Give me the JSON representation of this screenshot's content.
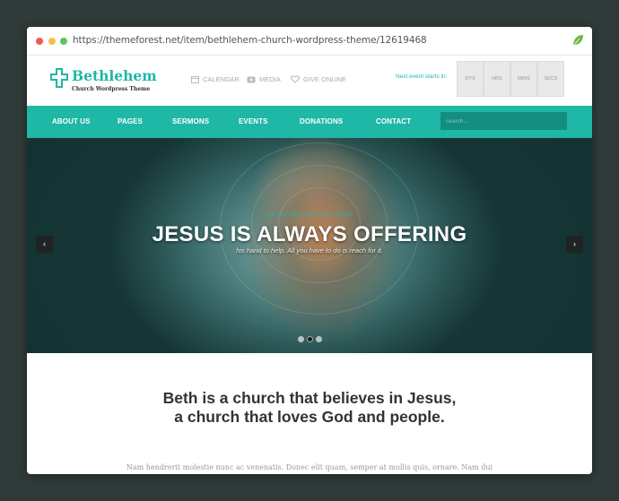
{
  "browser": {
    "url": "https://themeforest.net/item/bethlehem-church-wordpress-theme/12619468"
  },
  "logo": {
    "name": "Bethlehem",
    "tagline": "Church Wordpress Theme"
  },
  "header_links": [
    {
      "label": "CALENDAR",
      "icon": "calendar-icon"
    },
    {
      "label": "MEDIA",
      "icon": "media-icon"
    },
    {
      "label": "GIVE ONLINE",
      "icon": "heart-icon"
    }
  ],
  "countdown": {
    "label": "Next event starts in:",
    "units": [
      "DYS",
      "HRS",
      "MINS",
      "SECS"
    ]
  },
  "nav": {
    "items": [
      "ABOUT US",
      "PAGES",
      "SERMONS",
      "EVENTS",
      "DONATIONS",
      "CONTACT"
    ],
    "search_placeholder": "search..."
  },
  "hero": {
    "top_line": "Let your light shine before others",
    "title": "JESUS IS ALWAYS OFFERING",
    "subtitle": "his hand to help. All you have to do is reach for it.",
    "prev": "‹",
    "next": "›",
    "slides": 3,
    "active_slide": 1
  },
  "intro": {
    "heading_line1": "Beth is a church that believes in Jesus,",
    "heading_line2": "a church that loves God and people.",
    "paragraph": "Nam hendrerit molestie nunc ac venenatis. Donec elit quam, semper at mollis quis, ornare. Nam dui nunc, tinc- idunt quis scelerisque ac, aliquet sit amet turpis. Aliquam vulputate, lacus ac bibendum vehicula, nisi libero fringilla orci."
  },
  "colors": {
    "accent": "#1fb7a6",
    "background": "#2f3a39"
  }
}
